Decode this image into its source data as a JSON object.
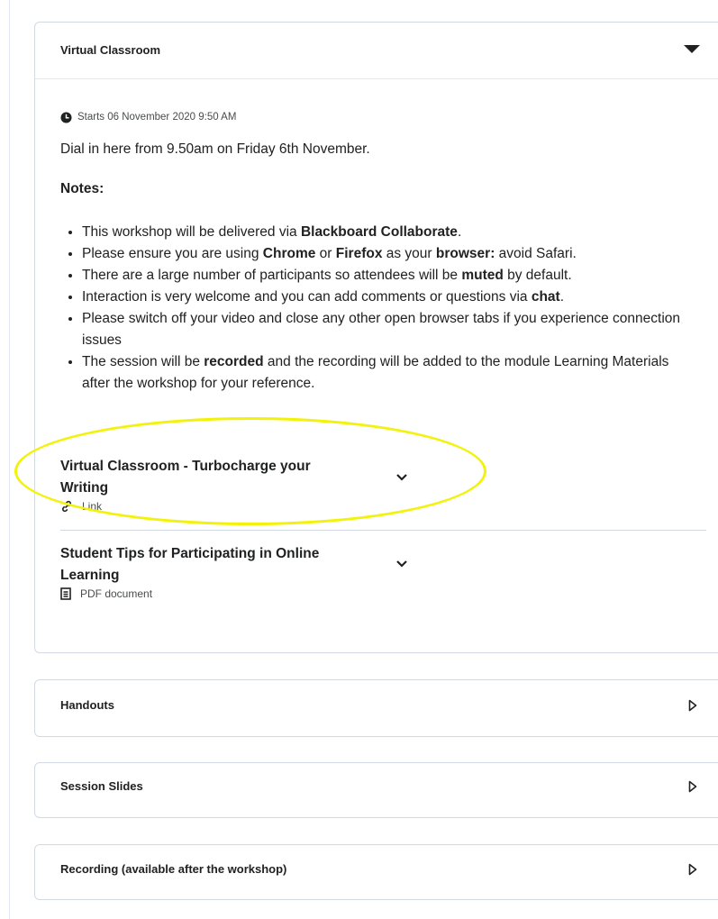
{
  "main_panel": {
    "title": "Virtual Classroom",
    "starts": "Starts 06 November 2020 9:50 AM",
    "intro": "Dial in here from 9.50am on Friday 6th November.",
    "notes_heading": "Notes:",
    "notes": [
      {
        "t1": "This workshop will be delivered via ",
        "b1": "Blackboard Collaborate",
        "t2": "."
      },
      {
        "t1": "Please ensure you are using ",
        "b1": "Chrome",
        "t2": " or ",
        "b2": "Firefox",
        "t3": " as your ",
        "b3": "browser:",
        "t4": " avoid Safari."
      },
      {
        "t1": "There are a large number of participants so attendees will be ",
        "b1": "muted",
        "t2": " by default."
      },
      {
        "t1": "Interaction is very welcome and you can add comments or questions via ",
        "b1": "chat",
        "t2": "."
      },
      {
        "t1": "Please switch off your video and close any other open browser tabs if you experience connection issues"
      },
      {
        "t1": "The session will be ",
        "b1": "recorded",
        "t2": " and the recording will be added to the module Learning Materials after the workshop for your reference."
      }
    ],
    "items": [
      {
        "title": "Virtual Classroom - Turbocharge your Writing",
        "type": "Link",
        "icon": "link-icon"
      },
      {
        "title": "Student Tips for Participating in Online Learning",
        "type": "PDF document",
        "icon": "document-icon"
      }
    ]
  },
  "collapsed_panels": [
    {
      "title": "Handouts"
    },
    {
      "title": "Session Slides"
    },
    {
      "title": "Recording (available after the workshop)"
    }
  ],
  "colors": {
    "highlight": "#f2f20a",
    "border": "#d3d9e3",
    "text": "#202122"
  }
}
